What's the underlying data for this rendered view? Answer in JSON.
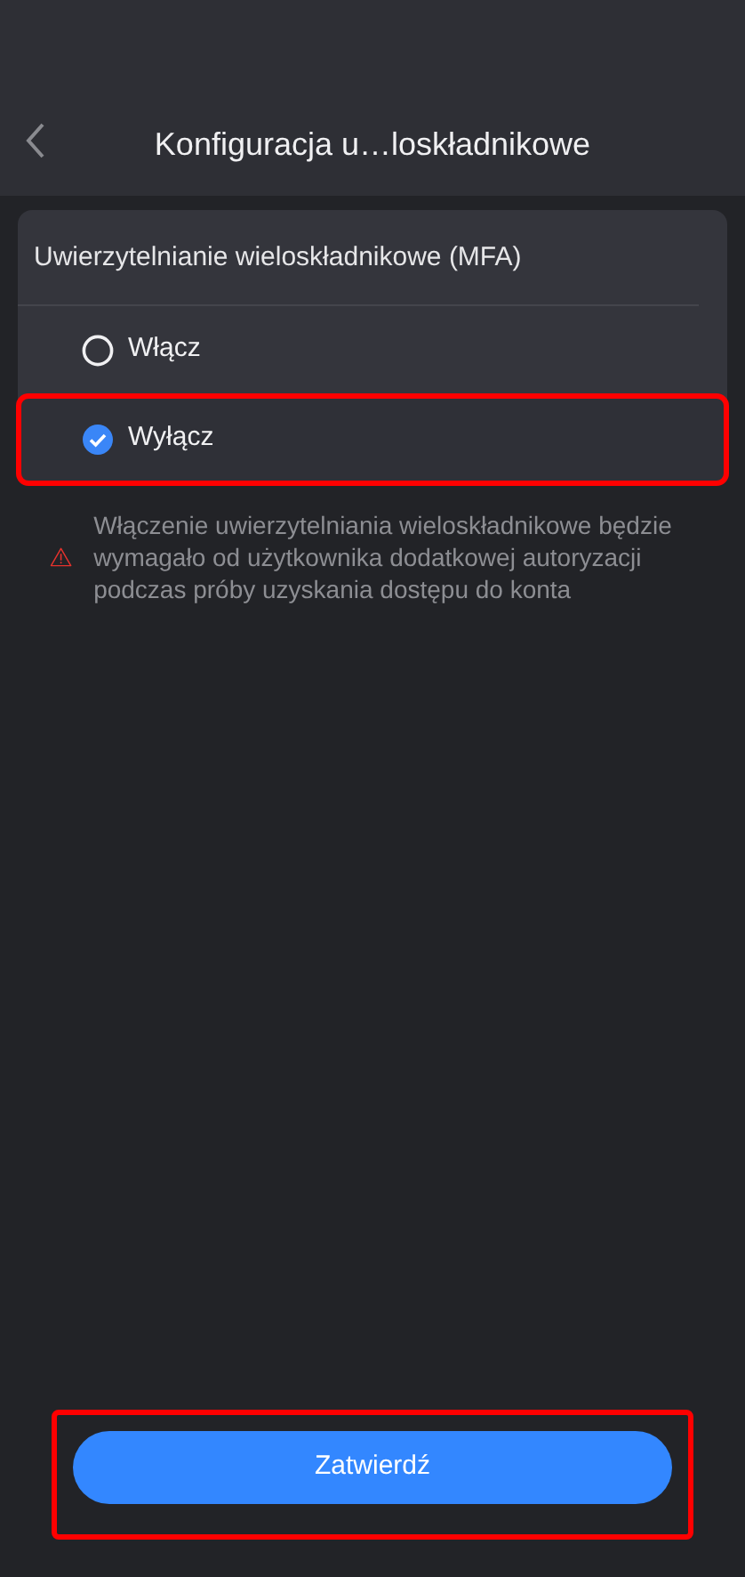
{
  "header": {
    "title": "Konfiguracja u…loskładnikowe"
  },
  "section": {
    "title": "Uwierzytelnianie wieloskładnikowe (MFA)",
    "options": [
      {
        "label": "Włącz",
        "selected": false,
        "highlighted": false
      },
      {
        "label": "Wyłącz",
        "selected": true,
        "highlighted": true
      }
    ]
  },
  "warning": {
    "text": "Włączenie uwierzytelniania wieloskładnikowe będzie wymagało od użytkownika dodatkowej autoryzacji podczas próby uzyskania dostępu do konta"
  },
  "submit": {
    "label": "Zatwierdź",
    "highlighted": true
  }
}
